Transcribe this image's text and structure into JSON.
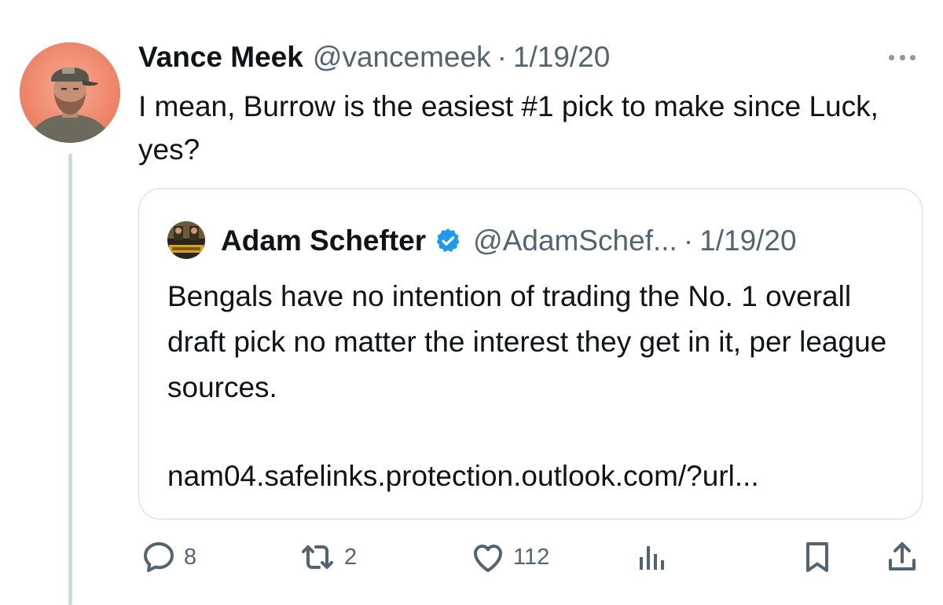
{
  "tweet": {
    "author_name": "Vance Meek",
    "author_handle": "@vancemeek",
    "separator": "·",
    "date": "1/19/20",
    "text": "I mean, Burrow is the easiest #1 pick to make since Luck, yes?",
    "more_icon": "more-horizontal-icon"
  },
  "quoted_tweet": {
    "author_name": "Adam Schefter",
    "verified_icon": "verified-badge-icon",
    "author_handle": "@AdamSchef...",
    "separator": "·",
    "date": "1/19/20",
    "text": "Bengals have no intention of trading the No. 1 overall draft pick no matter the interest they get in it, per league sources.",
    "link": "nam04.safelinks.protection.outlook.com/?url..."
  },
  "actions": {
    "reply": {
      "icon": "reply-icon",
      "count": "8"
    },
    "retweet": {
      "icon": "retweet-icon",
      "count": "2"
    },
    "like": {
      "icon": "heart-icon",
      "count": "112"
    },
    "views": {
      "icon": "views-chart-icon"
    },
    "bookmark": {
      "icon": "bookmark-icon"
    },
    "share": {
      "icon": "share-icon"
    }
  },
  "colors": {
    "text_primary": "#0f1419",
    "text_secondary": "#536471",
    "border": "#cfd9de",
    "verified_blue": "#1d9bf0"
  }
}
